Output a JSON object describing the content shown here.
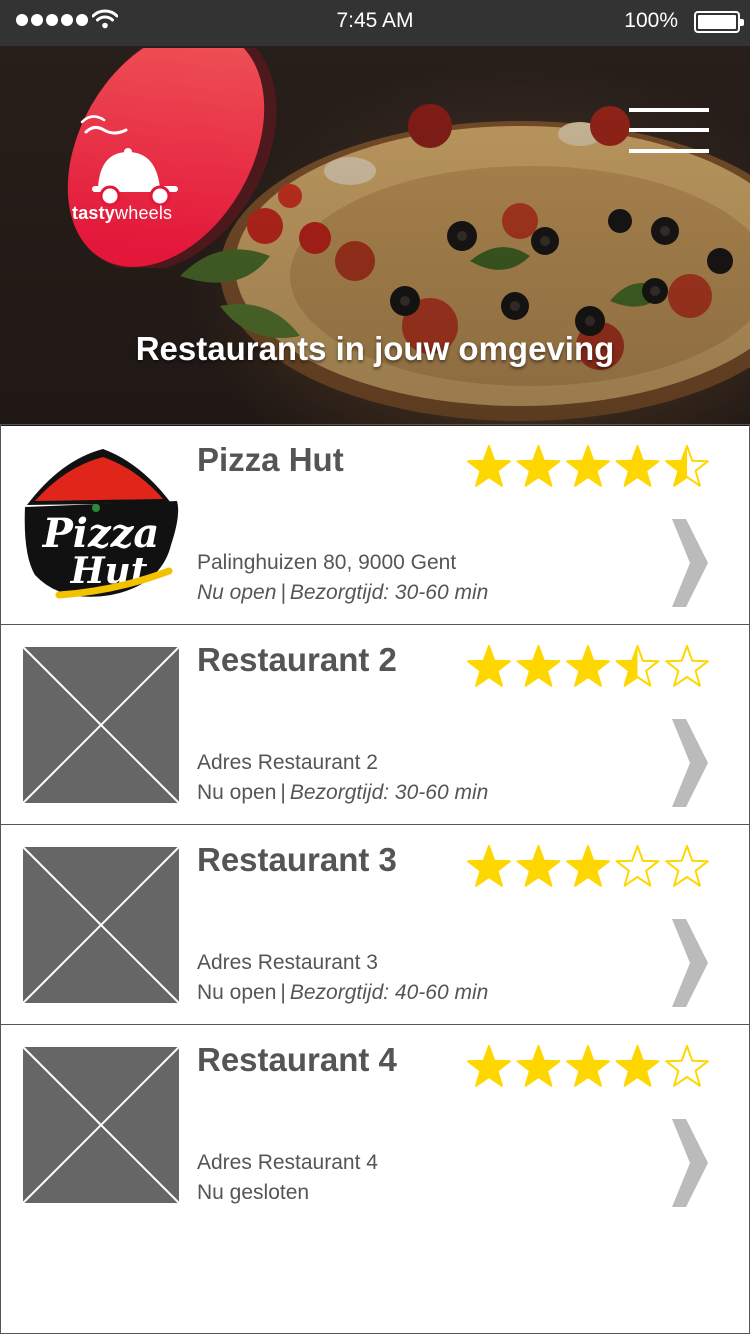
{
  "status_bar": {
    "time": "7:45 AM",
    "battery": "100%",
    "signal_bars": 5
  },
  "header": {
    "logo_text_bold": "tasty",
    "logo_text_light": "wheels",
    "title": "Restaurants in jouw omgeving",
    "menu_icon": "hamburger-menu-icon"
  },
  "colors": {
    "star": "#FFD700",
    "brand_red": "#E3233B",
    "text_gray": "#555555",
    "chevron_gray": "#BBBBBB"
  },
  "restaurants": [
    {
      "name": "Pizza Hut",
      "rating": 4.5,
      "address": "Palinghuizen 80, 9000 Gent",
      "status": "Nu open",
      "status_italic": true,
      "delivery": "Bezorgtijd: 30-60 min",
      "logo": "pizza-hut-logo"
    },
    {
      "name": "Restaurant 2",
      "rating": 3.5,
      "address": "Adres Restaurant 2",
      "status": "Nu open",
      "status_italic": false,
      "delivery": "Bezorgtijd: 30-60 min",
      "logo": "placeholder-image"
    },
    {
      "name": "Restaurant 3",
      "rating": 3,
      "address": "Adres Restaurant 3",
      "status": "Nu open",
      "status_italic": false,
      "delivery": "Bezorgtijd: 40-60 min",
      "logo": "placeholder-image"
    },
    {
      "name": "Restaurant 4",
      "rating": 4,
      "address": "Adres Restaurant 4",
      "status": "Nu gesloten",
      "status_italic": false,
      "delivery": "",
      "logo": "placeholder-image"
    }
  ]
}
